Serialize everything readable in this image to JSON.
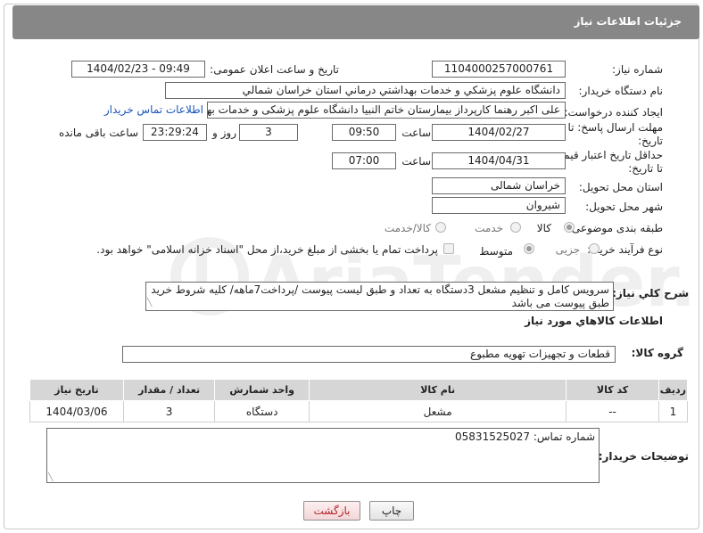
{
  "header": {
    "title": "جزئیات اطلاعات نیاز"
  },
  "form": {
    "need_number_label": "شماره نیاز:",
    "need_number": "1104000257000761",
    "announce_label": "تاریخ و ساعت اعلان عمومی:",
    "announce_value": "1404/02/23 - 09:49",
    "buyer_org_label": "نام دستگاه خریدار:",
    "buyer_org": "دانشگاه علوم پزشکي و خدمات بهداشتي درماني استان خراسان شمالي",
    "creator_label": "ایجاد کننده درخواست:",
    "creator": "علی اکبر رهنما کارپرداز بیمارستان خاتم النبیا دانشگاه علوم پزشکی و خدمات بهداشتی",
    "contact_link": "اطلاعات تماس خریدار",
    "reply_deadline_label_1": "مهلت ارسال پاسخ: تا",
    "reply_deadline_label_2": "تاریخ:",
    "reply_date": "1404/02/27",
    "time_label": "ساعت",
    "reply_time": "09:50",
    "days_value": "3",
    "days_label": "روز و",
    "remaining_time": "23:29:24",
    "remaining_label": "ساعت باقی مانده",
    "price_validity_label_1": "حداقل تاریخ اعتبار قیمت:",
    "price_validity_label_2": "تا تاریخ:",
    "price_validity_date": "1404/04/31",
    "price_validity_time": "07:00",
    "delivery_province_label": "استان محل تحویل:",
    "delivery_province": "خراسان شمالی",
    "delivery_city_label": "شهر محل تحویل:",
    "delivery_city": "شیروان",
    "category_label": "طبقه بندی موضوعی:",
    "category_options": [
      "کالا",
      "خدمت",
      "کالا/خدمت"
    ],
    "purchase_process_label": "نوع فرآیند خرید :",
    "process_options": [
      "جزیی",
      "متوسط"
    ],
    "payment_note": "پرداخت تمام یا بخشی از مبلغ خرید،از محل \"اسناد خزانه اسلامی\" خواهد بود."
  },
  "description": {
    "label": "شرح کلي نیاز:",
    "text": "سرویس کامل و تنظیم مشعل 3دستگاه به تعداد و طبق لیست پیوست /پرداخت7ماهه/ کلیه شروط خرید طبق پیوست می باشد"
  },
  "goods_section": {
    "title": "اطلاعات کالاهاي مورد نیاز",
    "group_label": "گروه کالا:",
    "group_value": "قطعات و تجهیزات تهویه مطبوع"
  },
  "items_table": {
    "headers": [
      "ردیف",
      "کد کالا",
      "نام کالا",
      "واحد شمارش",
      "تعداد / مقدار",
      "تاریخ نیاز"
    ],
    "rows": [
      [
        "1",
        "--",
        "مشعل",
        "دستگاه",
        "3",
        "1404/03/06"
      ]
    ]
  },
  "buyer_notes": {
    "label": "توضیحات خریدار:",
    "text": "شماره تماس: 05831525027"
  },
  "buttons": {
    "print": "چاپ",
    "back": "بازگشت"
  },
  "watermark": {
    "text": "AriaTender.neT"
  },
  "colors": {
    "header_bg": "#878787",
    "table_header_bg": "#d6d6d6",
    "link": "#1a56b8",
    "back_button_text": "#b0252d"
  }
}
